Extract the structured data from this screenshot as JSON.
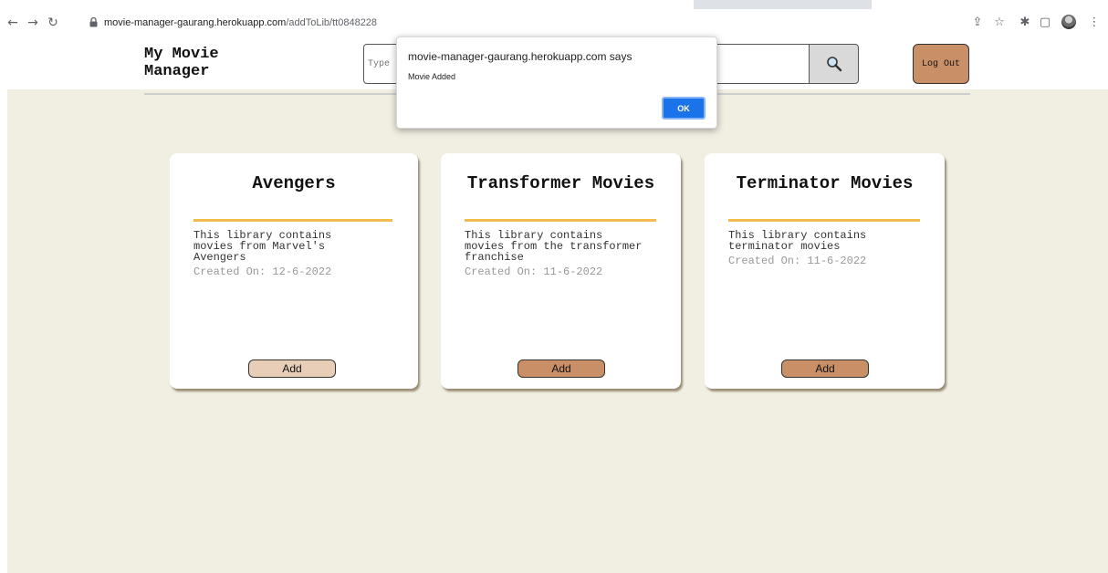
{
  "browser": {
    "url_host": "movie-manager-gaurang.herokuapp.com",
    "url_path": "/addToLib/tt0848228"
  },
  "app": {
    "brand": "My Movie Manager",
    "search_placeholder": "Type",
    "logout_label": "Log Out"
  },
  "libraries": [
    {
      "title": "Avengers",
      "description": "This library contains movies from Marvel's Avengers",
      "created": "Created On: 12-6-2022",
      "add_label": "Add"
    },
    {
      "title": "Transformer Movies",
      "description": "This library contains movies from the transformer franchise",
      "created": "Created On: 11-6-2022",
      "add_label": "Add"
    },
    {
      "title": "Terminator Movies",
      "description": "This library contains terminator movies",
      "created": "Created On: 11-6-2022",
      "add_label": "Add"
    }
  ],
  "dialog": {
    "title": "movie-manager-gaurang.herokuapp.com says",
    "message": "Movie Added",
    "ok_label": "OK"
  },
  "colors": {
    "page_bg": "#f1efe2",
    "accent_bar": "#f2bc4e",
    "button_brown": "#c98f67",
    "dialog_ok": "#1a73e8"
  }
}
